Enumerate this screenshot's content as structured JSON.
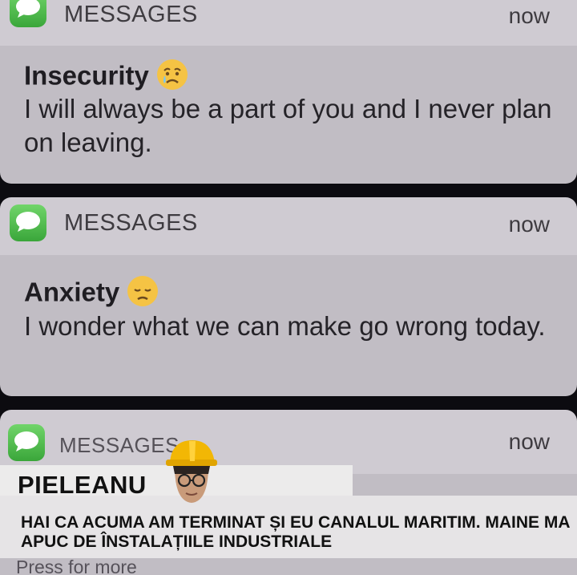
{
  "notifications": [
    {
      "app_name": "MESSAGES",
      "time": "now",
      "sender": "Insecurity",
      "emoji": "crying-face-icon",
      "message": "I will always be a part of you and I never plan on leaving."
    },
    {
      "app_name": "MESSAGES",
      "time": "now",
      "sender": "Anxiety",
      "emoji": "disappointed-face-icon",
      "message": "I wonder what we can make go wrong today."
    },
    {
      "app_name": "MESSAGES",
      "time": "now",
      "sender": "PIELEANU",
      "message": "HAI CA ACUMA AM TERMINAT ȘI EU CANALUL MARITIM. MAINE MA APUC DE ÎNSTALAȚIILE INDUSTRIALE"
    }
  ],
  "footer": {
    "hint": "Press for more"
  },
  "colors": {
    "header_bg": "#cfcbd2",
    "body_bg": "#c1bdc4",
    "messages_green": "#4cbb47",
    "overlay_bg": "#ecebeb",
    "helmet_yellow": "#f2b705"
  },
  "icons": [
    "messages-app-icon",
    "crying-face-icon",
    "disappointed-face-icon",
    "hard-hat-icon"
  ]
}
